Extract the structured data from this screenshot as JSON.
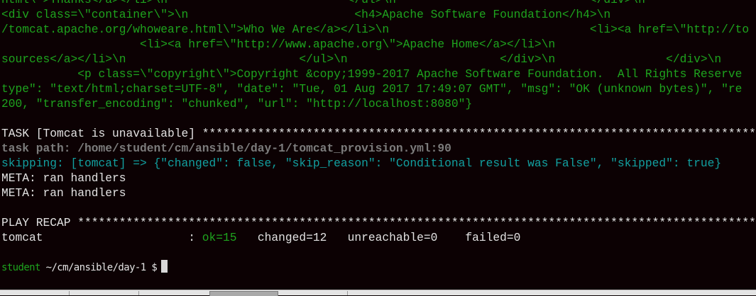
{
  "colors": {
    "background": "#0c0103",
    "green": "#1ea41e",
    "cyan": "#12a0a0",
    "dim": "#7c7c7c",
    "text": "#e2e2e2"
  },
  "output": [
    "html\\\">Thanks</a></li>\\n                          </ul>\\n                            </div>\\n                    </div>\\n",
    "<div class=\\\"container\\\">\\n                        <h4>Apache Software Foundation</h4>\\n",
    "/tomcat.apache.org/whoweare.html\\\">Who We Are</a></li>\\n                             <li><a href=\\\"http://to",
    "                    <li><a href=\\\"http://www.apache.org\\\">Apache Home</a></li>\\n",
    "sources</a></li>\\n                         </ul>\\n                      </div>\\n                </div>\\n",
    "           <p class=\\\"copyright\\\">Copyright &copy;1999-2017 Apache Software Foundation.  All Rights Reserve",
    "type\": \"text/html;charset=UTF-8\", \"date\": \"Tue, 01 Aug 2017 17:49:07 GMT\", \"msg\": \"OK (unknown bytes)\", \"re",
    "200, \"transfer_encoding\": \"chunked\", \"url\": \"http://localhost:8080\"}"
  ],
  "task": {
    "header": "TASK [Tomcat is unavailable] ************************************************************************************",
    "path": "task path: /home/student/cm/ansible/day-1/tomcat_provision.yml:90",
    "skipping": "skipping: [tomcat] => {\"changed\": false, \"skip_reason\": \"Conditional result was False\", \"skipped\": true}",
    "meta1": "META: ran handlers",
    "meta2": "META: ran handlers"
  },
  "recap": {
    "header": "PLAY RECAP ******************************************************************************************************",
    "host": "tomcat                     : ",
    "ok": "ok=15",
    "rest": "   changed=12   unreachable=0    failed=0"
  },
  "prompt": {
    "user": "student",
    "path": " ~/cm/ansible/day-1 $"
  }
}
